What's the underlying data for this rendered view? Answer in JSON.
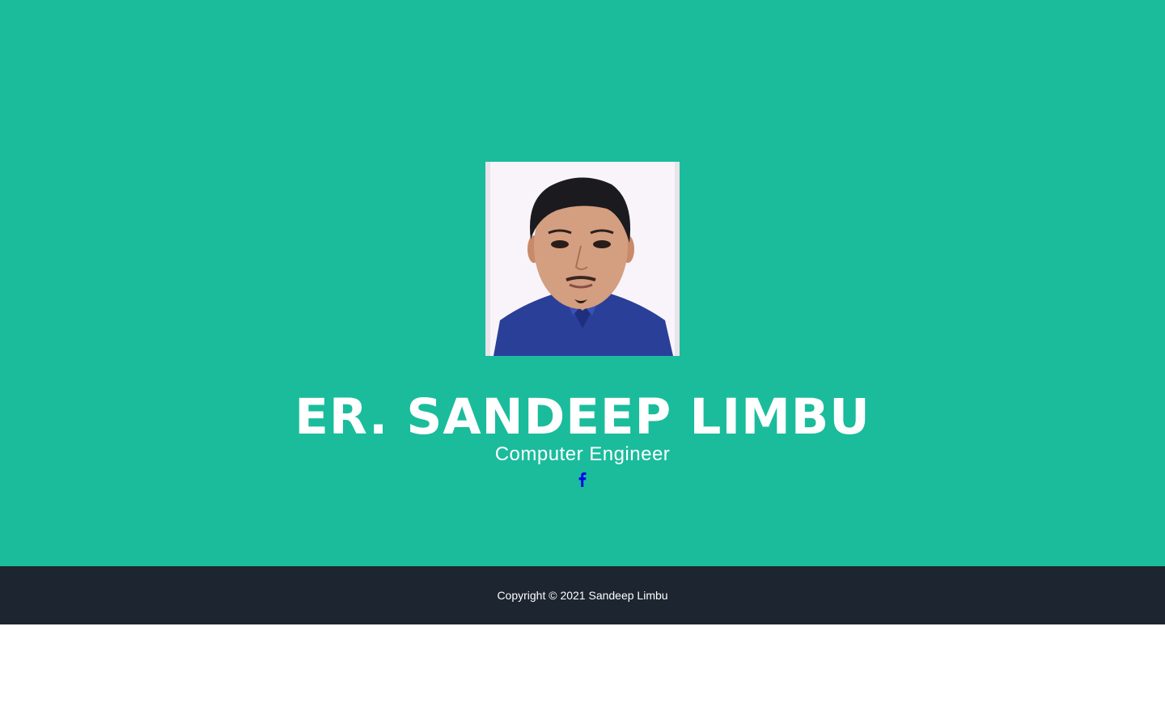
{
  "hero": {
    "name": "ER. SANDEEP LIMBU",
    "title": "Computer Engineer",
    "social": [
      {
        "icon": "facebook-icon",
        "color": "#0000ee"
      }
    ],
    "colors": {
      "background": "#1abc9c",
      "text": "#ffffff"
    }
  },
  "footer": {
    "copyright": "Copyright © 2021 Sandeep Limbu",
    "colors": {
      "background": "#1d2530",
      "text": "#ffffff"
    }
  }
}
